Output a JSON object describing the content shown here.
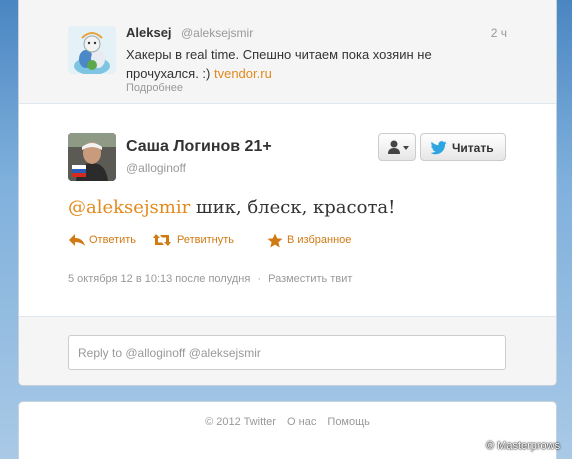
{
  "previous_tweet": {
    "name": "Aleksej",
    "handle": "@aleksejsmir",
    "time": "2 ч",
    "text": "Хакеры в real time. Спешно читаем пока хозяин не прочухался. :) ",
    "link": "tvendor.ru",
    "details": "Подробнее"
  },
  "tweet": {
    "name": "Саша Логинов 21+",
    "handle": "@alloginoff",
    "follow_label": "Читать",
    "mention": "@aleksejsmir",
    "text": " шик, блеск, красота!",
    "actions": {
      "reply": "Ответить",
      "retweet": "Ретвитнуть",
      "favorite": "В избранное"
    },
    "timestamp": "5 октября 12 в 10:13 после полудня",
    "separator": "·",
    "embed": "Разместить твит"
  },
  "reply": {
    "placeholder": "Reply to @alloginoff @aleksejsmir"
  },
  "footer": {
    "copyright": "© 2012 Twitter",
    "about": "О нас",
    "help": "Помощь"
  },
  "watermark": "© Masterprows",
  "colors": {
    "accent": "#e38a1c",
    "action": "#d07a14",
    "twitter_blue": "#2ca5e0",
    "background": "#7fb0dc"
  },
  "icons": {
    "user_menu": "user-dropdown-icon",
    "follow": "twitter-bird-icon",
    "reply": "reply-arrow-icon",
    "retweet": "retweet-icon",
    "favorite": "star-icon"
  }
}
